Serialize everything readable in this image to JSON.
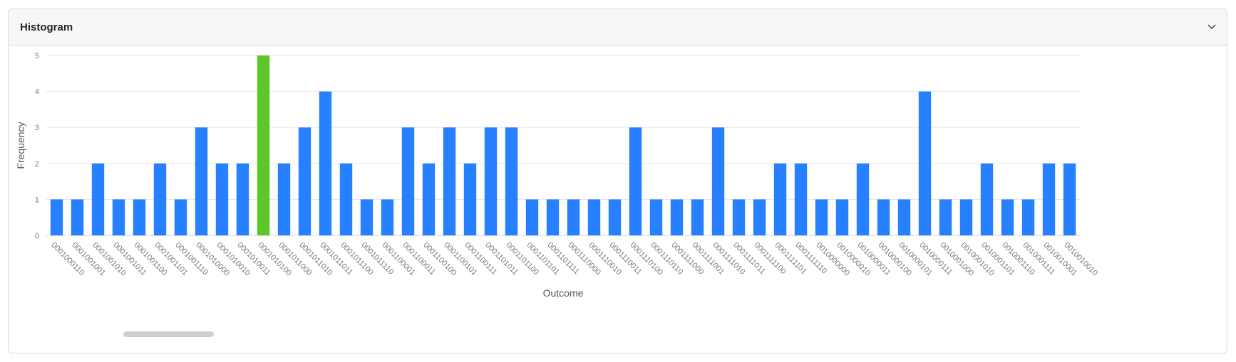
{
  "panel": {
    "title": "Histogram",
    "collapse_icon": "chevron-down-icon"
  },
  "colors": {
    "bar": "#2680ff",
    "highlight": "#5cc62b",
    "grid": "#e6e6e6",
    "axis_text": "#7a7a7a"
  },
  "chart_data": {
    "type": "bar",
    "xlabel": "Outcome",
    "ylabel": "Frequency",
    "ylim": [
      0,
      5
    ],
    "yticks": [
      0,
      1,
      2,
      3,
      4,
      5
    ],
    "grid": true,
    "highlight_category": "0001010100",
    "categories": [
      "0001000110",
      "0001001001",
      "0001001010",
      "0001001011",
      "0001001100",
      "0001001101",
      "0001001110",
      "0001010000",
      "0001010010",
      "0001010011",
      "0001010100",
      "0001011000",
      "0001011010",
      "0001011011",
      "0001011100",
      "0001011110",
      "0001100001",
      "0001100011",
      "0001100100",
      "0001100101",
      "0001100111",
      "0001101011",
      "0001101100",
      "0001101101",
      "0001101111",
      "0001110000",
      "0001110010",
      "0001110011",
      "0001110100",
      "0001110110",
      "0001111000",
      "0001111001",
      "0001111010",
      "0001111011",
      "0001111100",
      "0001111101",
      "0001111110",
      "0010000000",
      "0010000010",
      "0010000011",
      "0010000100",
      "0010000101",
      "0010000111",
      "0010001000",
      "0010001010",
      "0010001101",
      "0010001110",
      "0010001111",
      "0010010001",
      "0010010010"
    ],
    "values": [
      1,
      1,
      2,
      1,
      1,
      2,
      1,
      3,
      2,
      2,
      5,
      2,
      3,
      4,
      2,
      1,
      1,
      3,
      2,
      3,
      2,
      3,
      3,
      1,
      1,
      1,
      1,
      1,
      3,
      1,
      1,
      1,
      3,
      1,
      1,
      2,
      2,
      1,
      1,
      2,
      1,
      1,
      4,
      1,
      1,
      2,
      1,
      1,
      2,
      2
    ]
  }
}
